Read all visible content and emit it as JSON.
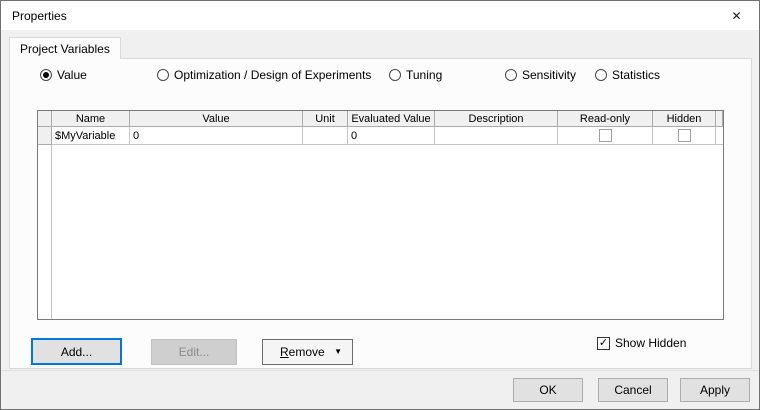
{
  "window": {
    "title": "Properties"
  },
  "icons": {
    "close": "✕",
    "dropdown": "▼",
    "check": "✓"
  },
  "tabs": [
    {
      "label": "Project Variables",
      "selected": true
    }
  ],
  "radio_group": [
    {
      "label": "Value",
      "selected": true
    },
    {
      "label": "Optimization / Design of Experiments",
      "selected": false
    },
    {
      "label": "Tuning",
      "selected": false
    },
    {
      "label": "Sensitivity",
      "selected": false
    },
    {
      "label": "Statistics",
      "selected": false
    }
  ],
  "table": {
    "columns": [
      "Name",
      "Value",
      "Unit",
      "Evaluated Value",
      "Description",
      "Read-only",
      "Hidden"
    ],
    "rows": [
      {
        "name": "$MyVariable",
        "value": "0",
        "unit": "",
        "evaluated_value": "0",
        "description": "",
        "read_only": false,
        "hidden": false
      }
    ]
  },
  "actions": {
    "add": "Add...",
    "edit": "Edit...",
    "remove_accel": "R",
    "remove_rest": "emove"
  },
  "show_hidden": {
    "label": "Show Hidden",
    "checked": true
  },
  "footer": {
    "ok": "OK",
    "cancel": "Cancel",
    "apply": "Apply"
  },
  "colors": {
    "accent": "#0078d7",
    "titlebar": "#ffffff",
    "dialog_bg": "#f0f0f0",
    "pane_bg": "#fcfcfc"
  }
}
